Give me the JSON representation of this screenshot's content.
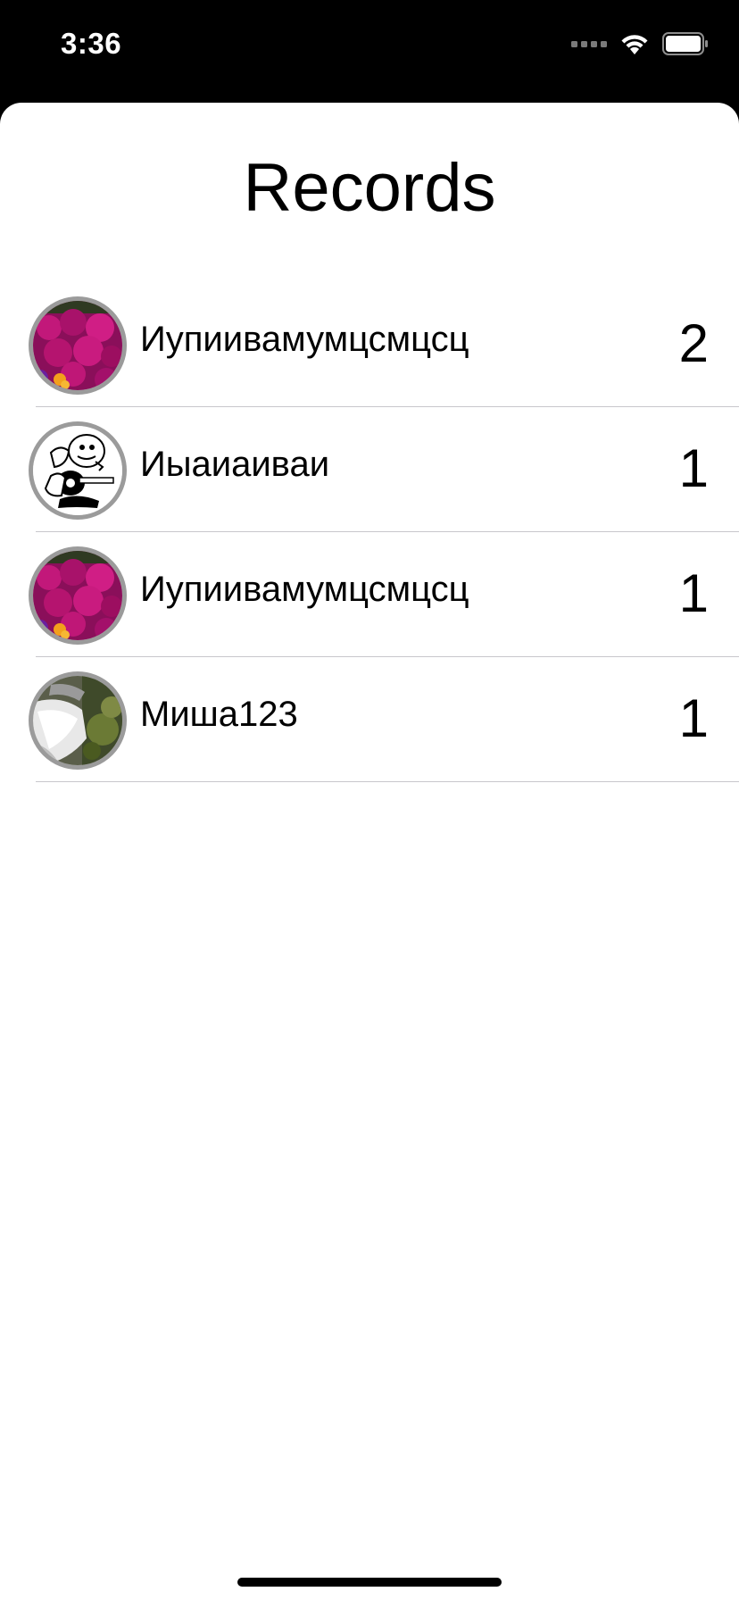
{
  "status_bar": {
    "time": "3:36",
    "signal_icon": "cellular-signal-icon",
    "wifi_icon": "wifi-icon",
    "battery_icon": "battery-icon"
  },
  "screen": {
    "title": "Records"
  },
  "records": [
    {
      "name": "Иупиивамумцсмцсц",
      "score": "2",
      "avatar": "flowers-photo"
    },
    {
      "name": "Иыаиаиваи",
      "score": "1",
      "avatar": "cartoon-character-drawing"
    },
    {
      "name": "Иупиивамумцсмцсц",
      "score": "1",
      "avatar": "flowers-photo"
    },
    {
      "name": "Миша123",
      "score": "1",
      "avatar": "waterfall-photo"
    }
  ],
  "colors": {
    "background": "#ffffff",
    "status_bar": "#000000",
    "separator": "#c8c7cc",
    "avatar_border": "#9b9b9b"
  }
}
